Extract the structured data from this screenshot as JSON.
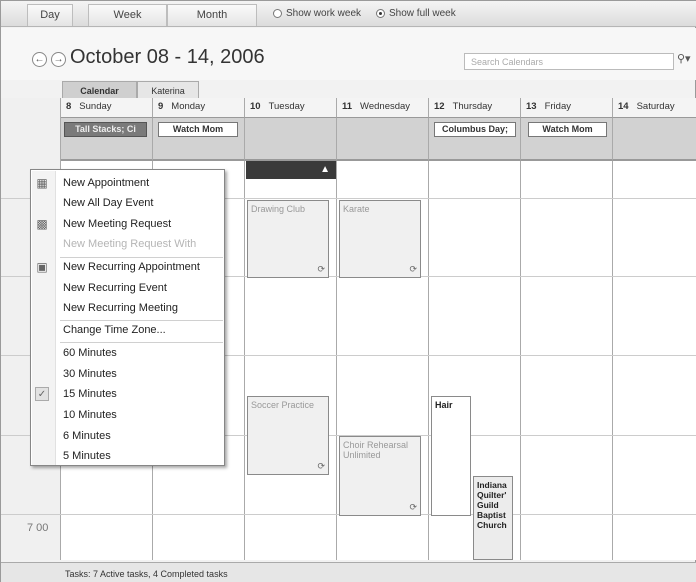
{
  "views": {
    "day": "Day",
    "week": "Week",
    "month": "Month"
  },
  "week_options": {
    "work_week": "Show work week",
    "full_week": "Show full week",
    "selected": "full_week"
  },
  "header": {
    "date_range": "October 08 - 14, 2006",
    "search_placeholder": "Search Calendars"
  },
  "calendar_tabs": [
    "Calendar",
    "Katerina"
  ],
  "days": [
    {
      "num": "8",
      "name": "Sunday"
    },
    {
      "num": "9",
      "name": "Monday"
    },
    {
      "num": "10",
      "name": "Tuesday"
    },
    {
      "num": "11",
      "name": "Wednesday"
    },
    {
      "num": "12",
      "name": "Thursday"
    },
    {
      "num": "13",
      "name": "Friday"
    },
    {
      "num": "14",
      "name": "Saturday"
    }
  ],
  "all_day_events": {
    "sun": "Tall Stacks; Ci",
    "mon": "Watch Mom",
    "thu": "Columbus Day;",
    "fri": "Watch Mom"
  },
  "events": {
    "drawing": "Drawing Club",
    "karate": "Karate",
    "soccer": "Soccer Practice",
    "choir": "Choir Rehearsal Unlimited",
    "hair": "Hair",
    "guild": "Indiana Quilter' Guild Baptist Church"
  },
  "time_label": "7 00",
  "context_menu": {
    "items": [
      "New Appointment",
      "New All Day Event",
      "New Meeting Request",
      "New Meeting Request With",
      "New Recurring Appointment",
      "New Recurring Event",
      "New Recurring Meeting",
      "Change Time Zone...",
      "60 Minutes",
      "30 Minutes",
      "15 Minutes",
      "10 Minutes",
      "6 Minutes",
      "5 Minutes"
    ],
    "checked": "15 Minutes"
  },
  "status": "Tasks: 7 Active tasks, 4 Completed tasks",
  "icons": {
    "back": "left-arrow-icon",
    "forward": "right-arrow-icon",
    "search": "magnifier-icon",
    "recurrence": "recurrence-icon",
    "check": "checkmark-icon"
  }
}
